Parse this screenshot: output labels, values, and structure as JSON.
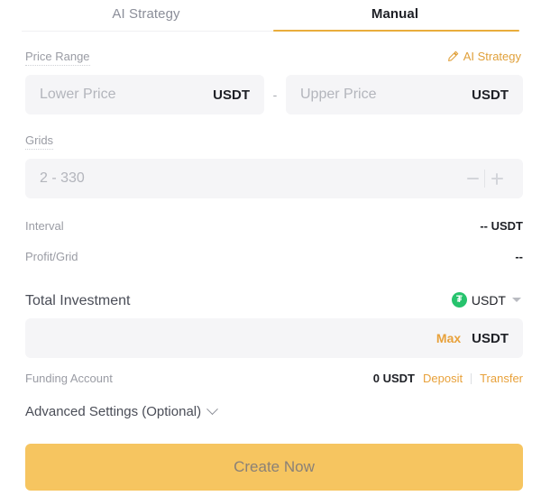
{
  "tabs": [
    {
      "label": "AI Strategy",
      "active": false
    },
    {
      "label": "Manual",
      "active": true
    }
  ],
  "price_range": {
    "label": "Price Range",
    "ai_link": {
      "label": "AI Strategy",
      "icon": "pencil-icon"
    },
    "lower": {
      "placeholder": "Lower Price",
      "value": "",
      "suffix": "USDT"
    },
    "separator": "-",
    "upper": {
      "placeholder": "Upper Price",
      "value": "",
      "suffix": "USDT"
    }
  },
  "grids": {
    "label": "Grids",
    "placeholder": "2 - 330",
    "value": "",
    "decrement_icon": "minus-icon",
    "increment_icon": "plus-icon"
  },
  "interval": {
    "label": "Interval",
    "value": "-- USDT"
  },
  "profit_grid": {
    "label": "Profit/Grid",
    "value": "--"
  },
  "total_investment": {
    "title": "Total Investment",
    "coin": {
      "symbol": "USDT",
      "glyph": "₮",
      "icon": "usdt-coin-icon",
      "color": "#26c36d"
    },
    "input": {
      "placeholder": "",
      "value": "",
      "max_label": "Max",
      "suffix": "USDT"
    }
  },
  "funding_account": {
    "label": "Funding Account",
    "balance": "0 USDT",
    "deposit_label": "Deposit",
    "transfer_label": "Transfer"
  },
  "advanced_settings": {
    "label": "Advanced Settings (Optional)",
    "icon": "chevron-down-icon"
  },
  "create_button": {
    "label": "Create Now"
  },
  "colors": {
    "accent": "#e9ad3c",
    "link": "#e8a13a",
    "button": "#f6c560",
    "field_bg": "#f5f5f7",
    "text_primary": "#1e2026",
    "text_muted": "#9a9ca4"
  }
}
